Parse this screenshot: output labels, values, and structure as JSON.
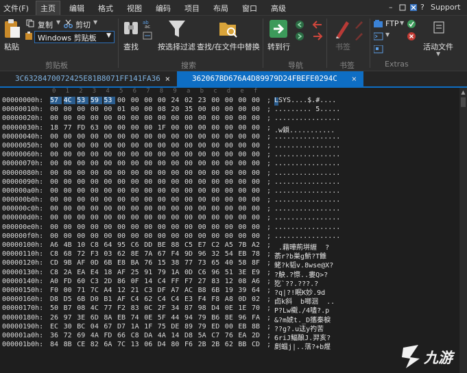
{
  "menu": {
    "items": [
      "文件(F)",
      "主页",
      "编辑",
      "格式",
      "视图",
      "编码",
      "项目",
      "布局",
      "窗口",
      "高级"
    ],
    "active_index": 1,
    "support_label": "Support"
  },
  "ribbon": {
    "paste_label": "粘贴",
    "copy_label": "复制",
    "cut_label": "剪切",
    "clipboard_combo_value": "Windows 剪贴板",
    "find_label": "查找",
    "filter_label": "按选择过滤",
    "find_in_files_label": "查找/在文件中替换",
    "goto_label": "转到行",
    "bookmark_label": "书签",
    "ftp_label": "FTP",
    "active_file_label": "活动文件",
    "groups": {
      "clipboard": "剪贴板",
      "search": "搜索",
      "navigation": "导航",
      "bookmark": "书签",
      "extras": "Extras"
    }
  },
  "tabs": [
    {
      "label": "3C6328470072425E81B8071FF141FA36",
      "close": "×",
      "active": false
    },
    {
      "label": "362067BD676A4D89979D24FBEFE0294C",
      "close": "×",
      "active": true
    }
  ],
  "ruler": [
    "0",
    "1",
    "2",
    "3",
    "4",
    "5",
    "6",
    "7",
    "8",
    "9",
    "a",
    "b",
    "c",
    "d",
    "e",
    "f"
  ],
  "hex_rows": [
    {
      "addr": "00000000h:",
      "bytes": [
        "57",
        "4C",
        "53",
        "59",
        "53",
        "00",
        "00",
        "00",
        "00",
        "24",
        "02",
        "23",
        "00",
        "00",
        "00",
        "00"
      ],
      "ascii": "LSYS....$.#...."
    },
    {
      "addr": "00000010h:",
      "bytes": [
        "00",
        "00",
        "00",
        "00",
        "00",
        "01",
        "00",
        "00",
        "08",
        "20",
        "35",
        "00",
        "00",
        "00",
        "00",
        "00"
      ],
      "ascii": "......... 5....."
    },
    {
      "addr": "00000020h:",
      "bytes": [
        "00",
        "00",
        "00",
        "00",
        "00",
        "00",
        "00",
        "00",
        "00",
        "00",
        "00",
        "00",
        "00",
        "00",
        "00",
        "00"
      ],
      "ascii": "................"
    },
    {
      "addr": "00000030h:",
      "bytes": [
        "18",
        "77",
        "FD",
        "63",
        "00",
        "00",
        "00",
        "00",
        "1F",
        "00",
        "00",
        "00",
        "00",
        "00",
        "00",
        "00"
      ],
      "ascii": ".w鎻..........."
    },
    {
      "addr": "00000040h:",
      "bytes": [
        "00",
        "00",
        "00",
        "00",
        "00",
        "00",
        "00",
        "00",
        "00",
        "00",
        "00",
        "00",
        "00",
        "00",
        "00",
        "00"
      ],
      "ascii": "................"
    },
    {
      "addr": "00000050h:",
      "bytes": [
        "00",
        "00",
        "00",
        "00",
        "00",
        "00",
        "00",
        "00",
        "00",
        "00",
        "00",
        "00",
        "00",
        "00",
        "00",
        "00"
      ],
      "ascii": "................"
    },
    {
      "addr": "00000060h:",
      "bytes": [
        "00",
        "00",
        "00",
        "00",
        "00",
        "00",
        "00",
        "00",
        "00",
        "00",
        "00",
        "00",
        "00",
        "00",
        "00",
        "00"
      ],
      "ascii": "................"
    },
    {
      "addr": "00000070h:",
      "bytes": [
        "00",
        "00",
        "00",
        "00",
        "00",
        "00",
        "00",
        "00",
        "00",
        "00",
        "00",
        "00",
        "00",
        "00",
        "00",
        "00"
      ],
      "ascii": "................"
    },
    {
      "addr": "00000080h:",
      "bytes": [
        "00",
        "00",
        "00",
        "00",
        "00",
        "00",
        "00",
        "00",
        "00",
        "00",
        "00",
        "00",
        "00",
        "00",
        "00",
        "00"
      ],
      "ascii": "................"
    },
    {
      "addr": "00000090h:",
      "bytes": [
        "00",
        "00",
        "00",
        "00",
        "00",
        "00",
        "00",
        "00",
        "00",
        "00",
        "00",
        "00",
        "00",
        "00",
        "00",
        "00"
      ],
      "ascii": "................"
    },
    {
      "addr": "000000a0h:",
      "bytes": [
        "00",
        "00",
        "00",
        "00",
        "00",
        "00",
        "00",
        "00",
        "00",
        "00",
        "00",
        "00",
        "00",
        "00",
        "00",
        "00"
      ],
      "ascii": "................"
    },
    {
      "addr": "000000b0h:",
      "bytes": [
        "00",
        "00",
        "00",
        "00",
        "00",
        "00",
        "00",
        "00",
        "00",
        "00",
        "00",
        "00",
        "00",
        "00",
        "00",
        "00"
      ],
      "ascii": "................"
    },
    {
      "addr": "000000c0h:",
      "bytes": [
        "00",
        "00",
        "00",
        "00",
        "00",
        "00",
        "00",
        "00",
        "00",
        "00",
        "00",
        "00",
        "00",
        "00",
        "00",
        "00"
      ],
      "ascii": "................"
    },
    {
      "addr": "000000d0h:",
      "bytes": [
        "00",
        "00",
        "00",
        "00",
        "00",
        "00",
        "00",
        "00",
        "00",
        "00",
        "00",
        "00",
        "00",
        "00",
        "00",
        "00"
      ],
      "ascii": "................"
    },
    {
      "addr": "000000e0h:",
      "bytes": [
        "00",
        "00",
        "00",
        "00",
        "00",
        "00",
        "00",
        "00",
        "00",
        "00",
        "00",
        "00",
        "00",
        "00",
        "00",
        "00"
      ],
      "ascii": "................"
    },
    {
      "addr": "000000f0h:",
      "bytes": [
        "00",
        "00",
        "00",
        "00",
        "00",
        "00",
        "00",
        "00",
        "00",
        "00",
        "00",
        "00",
        "00",
        "00",
        "00",
        "00"
      ],
      "ascii": "................"
    },
    {
      "addr": "00000100h:",
      "bytes": [
        "A6",
        "4B",
        "10",
        "C8",
        "64",
        "95",
        "C6",
        "DD",
        "BE",
        "88",
        "C5",
        "E7",
        "C2",
        "A5",
        "7B",
        "A2"
      ],
      "ascii": " .藉曄荊垪緾  ?"
    },
    {
      "addr": "00000110h:",
      "bytes": [
        "C8",
        "68",
        "72",
        "F3",
        "03",
        "62",
        "8E",
        "7A",
        "67",
        "F4",
        "9D",
        "96",
        "32",
        "54",
        "EB",
        "78"
      ],
      "ascii": "萮r?b巣g魸?T雔"
    },
    {
      "addr": "00000120h:",
      "bytes": [
        "CD",
        "9B",
        "AF",
        "0D",
        "6B",
        "E8",
        "BA",
        "76",
        "15",
        "38",
        "77",
        "73",
        "65",
        "40",
        "58",
        "8F"
      ],
      "ascii": "蛯?k韬v.8wse@X?"
    },
    {
      "addr": "00000130h:",
      "bytes": [
        "C8",
        "2A",
        "EA",
        "E4",
        "18",
        "AF",
        "25",
        "91",
        "79",
        "1A",
        "0D",
        "C6",
        "96",
        "51",
        "3E",
        "E9"
      ],
      "ascii": "?觖.?憏..婁Q>?"
    },
    {
      "addr": "00000140h:",
      "bytes": [
        "A0",
        "FD",
        "60",
        "C3",
        "2D",
        "86",
        "0F",
        "14",
        "C4",
        "FF",
        "F7",
        "27",
        "83",
        "12",
        "08",
        "A6"
      ],
      "ascii": "犵`??.???.?"
    },
    {
      "addr": "00000150h:",
      "bytes": [
        "F0",
        "00",
        "71",
        "7C",
        "A4",
        "12",
        "21",
        "C3",
        "DF",
        "A7",
        "AC",
        "B8",
        "6B",
        "19",
        "39",
        "64"
      ],
      "ascii": "?q|?!眠K妙.9d"
    },
    {
      "addr": "00000160h:",
      "bytes": [
        "D8",
        "D5",
        "6B",
        "D0",
        "B1",
        "AF",
        "C4",
        "62",
        "C4",
        "C4",
        "E3",
        "F4",
        "F8",
        "A8",
        "0D",
        "02"
      ],
      "ascii": "卣k斜  b啷洄  .."
    },
    {
      "addr": "00000170h:",
      "bytes": [
        "50",
        "B7",
        "08",
        "4C",
        "77",
        "F2",
        "83",
        "0C",
        "2F",
        "34",
        "87",
        "98",
        "D4",
        "0E",
        "1E",
        "70"
      ],
      "ascii": "P?Lw欟./4嚍?.p"
    },
    {
      "addr": "00000180h:",
      "bytes": [
        "26",
        "97",
        "3E",
        "6D",
        "8A",
        "EB",
        "74",
        "0E",
        "5F",
        "44",
        "94",
        "79",
        "B6",
        "8E",
        "96",
        "FA"
      ],
      "ascii": "&?m婋t._D攜秦棙"
    },
    {
      "addr": "00000190h:",
      "bytes": [
        "EC",
        "30",
        "BC",
        "04",
        "67",
        "D7",
        "1A",
        "1F",
        "75",
        "DE",
        "89",
        "79",
        "ED",
        "00",
        "EB",
        "8B"
      ],
      "ascii": "??g?.u迬y礿苦"
    },
    {
      "addr": "000001a0h:",
      "bytes": [
        "36",
        "72",
        "69",
        "4A",
        "FD",
        "66",
        "C8",
        "DA",
        "4A",
        "14",
        "D8",
        "5A",
        "C7",
        "76",
        "EA",
        "2D"
      ],
      "ascii": "6riJ鰏酿J.羿亥?"
    },
    {
      "addr": "000001b0h:",
      "bytes": [
        "84",
        "8B",
        "CE",
        "82",
        "6A",
        "7C",
        "13",
        "06",
        "D4",
        "80",
        "F6",
        "2B",
        "2B",
        "62",
        "BB",
        "CD"
      ],
      "ascii": "剫蝹j|..萿?+b煋"
    }
  ],
  "watermark_text": "九游",
  "colors": {
    "accent": "#0e6ec4",
    "selection": "#2a5d8f",
    "background": "#1e1e1e",
    "ribbon": "#2d2d2d"
  },
  "icons": [
    "paste-icon",
    "copy-icon",
    "cut-icon",
    "find-icon",
    "filter-icon",
    "folder-search-icon",
    "goto-icon",
    "bookmark-icon",
    "ftp-icon",
    "active-file-icon"
  ]
}
